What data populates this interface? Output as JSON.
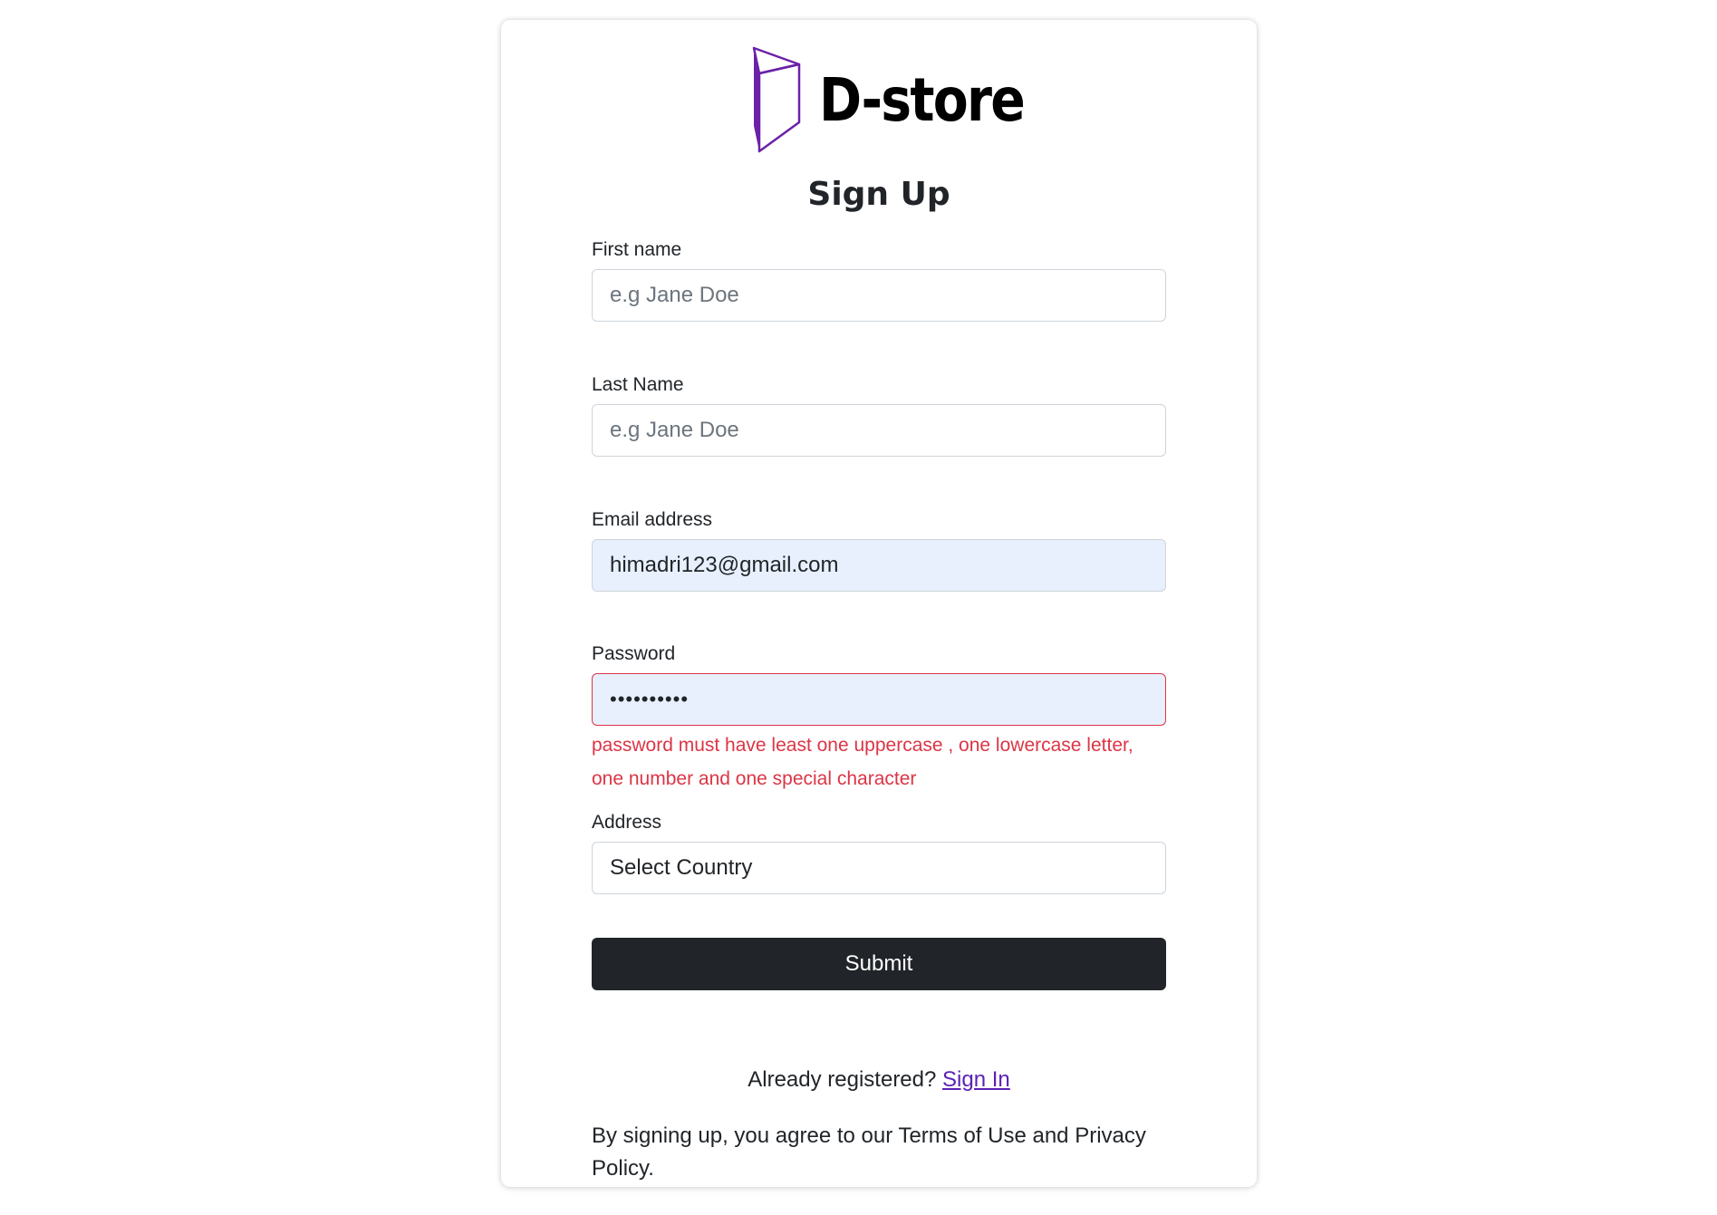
{
  "brand": {
    "name": "D-store",
    "logo_icon": "open-box-icon",
    "logo_color": "#6b21a8"
  },
  "page_title": "Sign Up",
  "form": {
    "first_name": {
      "label": "First name",
      "placeholder": "e.g Jane Doe",
      "value": ""
    },
    "last_name": {
      "label": "Last Name",
      "placeholder": "e.g Jane Doe",
      "value": ""
    },
    "email": {
      "label": "Email address",
      "value": "himadri123@gmail.com"
    },
    "password": {
      "label": "Password",
      "value": "••••••••••",
      "error_line1": "password must have least one uppercase , one lowercase letter,",
      "error_line2": "one number and one special character"
    },
    "address": {
      "label": "Address",
      "selected": "Select Country"
    },
    "submit_label": "Submit"
  },
  "signin": {
    "prompt": "Already registered?",
    "link_label": "Sign In"
  },
  "terms_line1": "By signing up, you agree to our Terms of Use and Privacy",
  "terms_line2": "Policy.",
  "colors": {
    "error": "#dc3545",
    "button": "#212529",
    "autofill": "#e8f0fe",
    "link": "#5b21b6"
  }
}
